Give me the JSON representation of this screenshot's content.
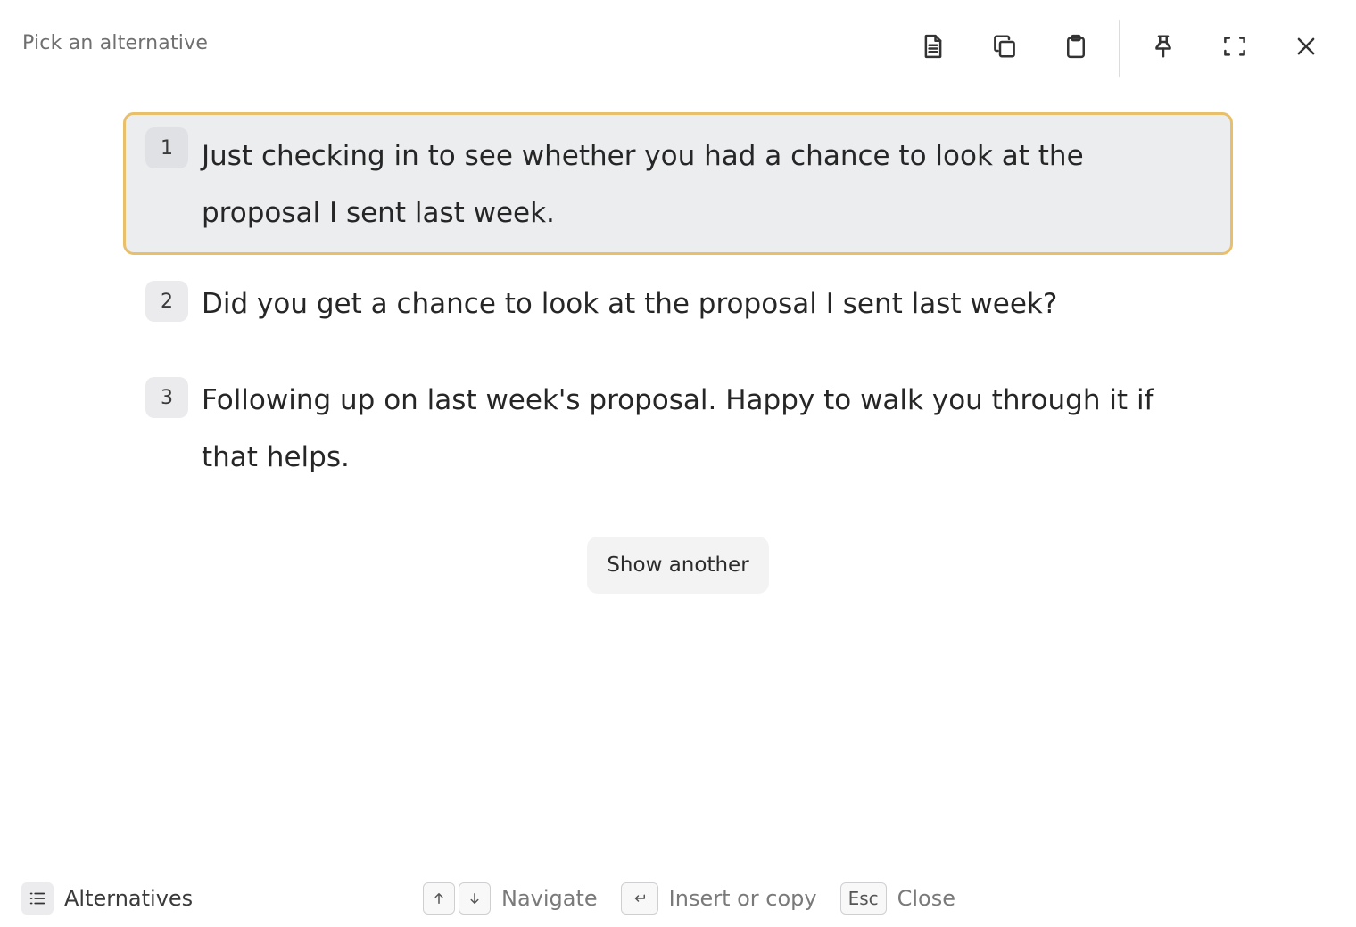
{
  "header": {
    "title": "Pick an alternative"
  },
  "toolbar": {
    "buttons": [
      {
        "name": "document-button",
        "icon": "document-icon"
      },
      {
        "name": "copy-button",
        "icon": "copy-icon"
      },
      {
        "name": "clipboard-button",
        "icon": "clipboard-icon"
      },
      {
        "name": "pin-button",
        "icon": "pin-icon"
      },
      {
        "name": "fullscreen-button",
        "icon": "fullscreen-icon"
      },
      {
        "name": "close-button",
        "icon": "close-icon"
      }
    ]
  },
  "options": [
    {
      "number": "1",
      "text": "Just checking in to see whether you had a chance to look at the proposal I sent last week.",
      "selected": true
    },
    {
      "number": "2",
      "text": "Did you get a chance to look at the proposal I sent last week?",
      "selected": false
    },
    {
      "number": "3",
      "text": "Following up on last week's proposal. Happy to walk you through it if that helps.",
      "selected": false
    }
  ],
  "show_another_label": "Show another",
  "footer": {
    "mode_label": "Alternatives",
    "navigate_label": "Navigate",
    "insert_label": "Insert or copy",
    "esc_key": "Esc",
    "close_label": "Close"
  },
  "colors": {
    "selected_border": "#e8bf6b",
    "selected_background": "#ecedef"
  }
}
